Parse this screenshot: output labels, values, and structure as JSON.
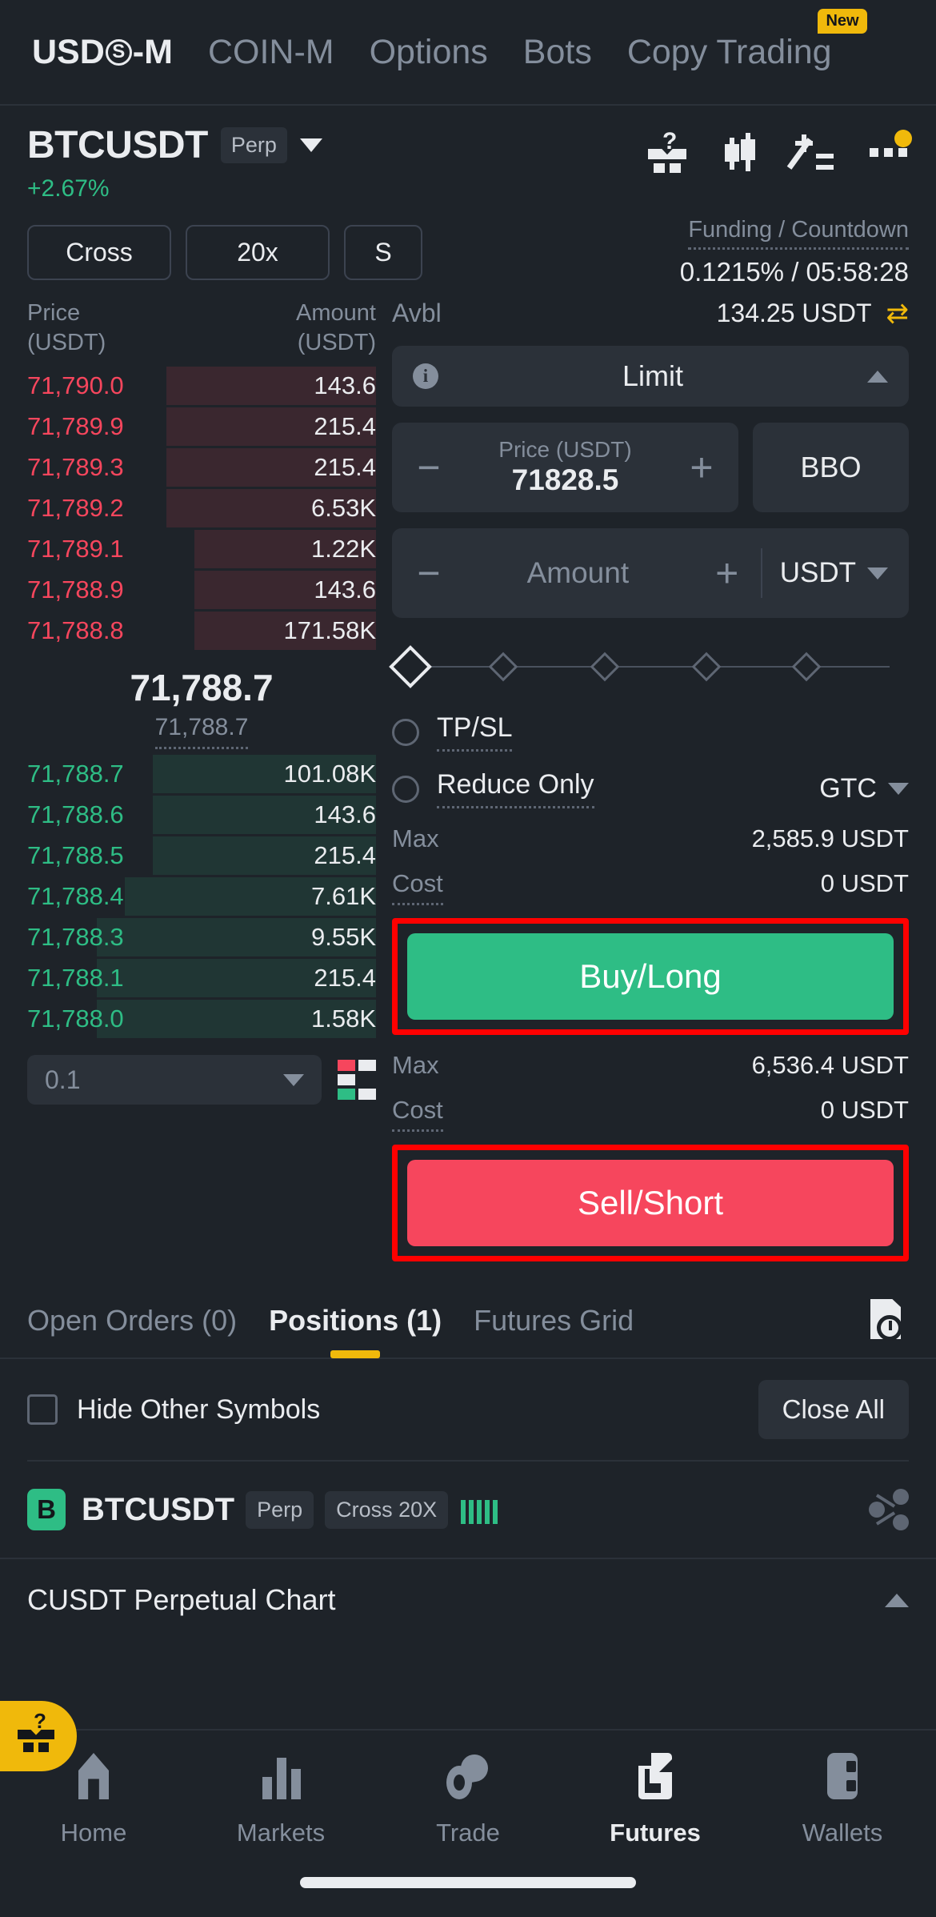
{
  "top_nav": {
    "items": [
      {
        "label": "USDⓈ-M",
        "active": true,
        "badge": ""
      },
      {
        "label": "COIN-M",
        "active": false,
        "badge": ""
      },
      {
        "label": "Options",
        "active": false,
        "badge": ""
      },
      {
        "label": "Bots",
        "active": false,
        "badge": ""
      },
      {
        "label": "Copy Trading",
        "active": false,
        "badge": "New"
      }
    ],
    "usds_prefix": "USD",
    "usds_circle": "S",
    "usds_suffix": "-M"
  },
  "symbol_header": {
    "name": "BTCUSDT",
    "contract_tag": "Perp",
    "change_pct": "+2.67%",
    "icons": [
      "mystery-box-icon",
      "candlestick-icon",
      "calculator-icon",
      "more-options-icon"
    ]
  },
  "mode_row": {
    "margin_mode": "Cross",
    "leverage": "20x",
    "mode_s": "S",
    "funding_label": "Funding / Countdown",
    "funding_value": "0.1215% / 05:58:28"
  },
  "orderbook": {
    "header_price": "Price",
    "header_price_unit": "(USDT)",
    "header_amount": "Amount",
    "header_amount_unit": "(USDT)",
    "asks": [
      {
        "price": "71,790.0",
        "amount": "143.6",
        "depth": 60
      },
      {
        "price": "71,789.9",
        "amount": "215.4",
        "depth": 60
      },
      {
        "price": "71,789.3",
        "amount": "215.4",
        "depth": 60
      },
      {
        "price": "71,789.2",
        "amount": "6.53K",
        "depth": 60
      },
      {
        "price": "71,789.1",
        "amount": "1.22K",
        "depth": 52
      },
      {
        "price": "71,788.9",
        "amount": "143.6",
        "depth": 52
      },
      {
        "price": "71,788.8",
        "amount": "171.58K",
        "depth": 52
      }
    ],
    "mid_price": "71,788.7",
    "mark_price": "71,788.7",
    "bids": [
      {
        "price": "71,788.7",
        "amount": "101.08K",
        "depth": 64
      },
      {
        "price": "71,788.6",
        "amount": "143.6",
        "depth": 64
      },
      {
        "price": "71,788.5",
        "amount": "215.4",
        "depth": 64
      },
      {
        "price": "71,788.4",
        "amount": "7.61K",
        "depth": 72
      },
      {
        "price": "71,788.3",
        "amount": "9.55K",
        "depth": 80
      },
      {
        "price": "71,788.1",
        "amount": "215.4",
        "depth": 80
      },
      {
        "price": "71,788.0",
        "amount": "1.58K",
        "depth": 80
      }
    ],
    "tick_size": "0.1"
  },
  "order_form": {
    "avbl_label": "Avbl",
    "avbl_value": "134.25 USDT",
    "swap_icon": "⇄",
    "order_type": "Limit",
    "price_caption": "Price (USDT)",
    "price_value": "71828.5",
    "bbo_label": "BBO",
    "amount_placeholder": "Amount",
    "amount_unit": "USDT",
    "tpsl_label": "TP/SL",
    "reduce_only_label": "Reduce Only",
    "tif": "GTC",
    "buy": {
      "max_label": "Max",
      "max_value": "2,585.9 USDT",
      "cost_label": "Cost",
      "cost_value": "0 USDT",
      "button": "Buy/Long"
    },
    "sell": {
      "max_label": "Max",
      "max_value": "6,536.4 USDT",
      "cost_label": "Cost",
      "cost_value": "0 USDT",
      "button": "Sell/Short"
    }
  },
  "tabs": {
    "items": [
      {
        "label": "Open Orders (0)",
        "active": false
      },
      {
        "label": "Positions (1)",
        "active": true
      },
      {
        "label": "Futures Grid",
        "active": false
      }
    ],
    "history_icon": "order-history-icon"
  },
  "positions": {
    "hide_other_label": "Hide Other Symbols",
    "close_all_label": "Close All",
    "row": {
      "logo": "B",
      "symbol": "BTCUSDT",
      "contract_tag": "Perp",
      "margin_tag": "Cross 20X"
    }
  },
  "chart_section": {
    "label": "CUSDT Perpetual  Chart"
  },
  "bottom_nav": {
    "items": [
      {
        "label": "Home",
        "icon": "home-icon",
        "active": false
      },
      {
        "label": "Markets",
        "icon": "markets-bars-icon",
        "active": false
      },
      {
        "label": "Trade",
        "icon": "trade-icon",
        "active": false
      },
      {
        "label": "Futures",
        "icon": "futures-icon",
        "active": true
      },
      {
        "label": "Wallets",
        "icon": "wallet-icon",
        "active": false
      }
    ]
  },
  "colors": {
    "background": "#1e2329",
    "panel": "#2b3139",
    "up_green": "#2ebd85",
    "down_red": "#f6465d",
    "accent_yellow": "#f0b90b",
    "text_primary": "#eaecef",
    "text_secondary": "#848e9c",
    "highlight_box": "#ff0000"
  }
}
